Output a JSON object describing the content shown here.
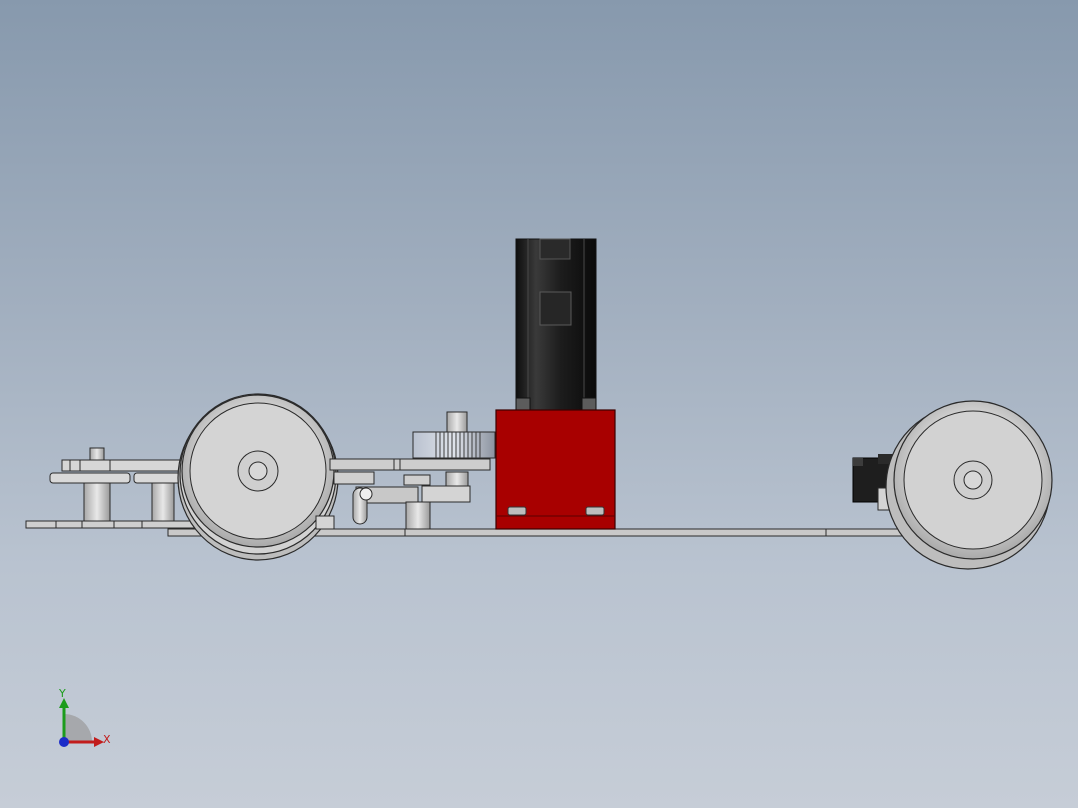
{
  "viewport": {
    "background_top": "#8799ad",
    "background_bottom": "#c6cdd7"
  },
  "model": {
    "motor_color": "#a60000",
    "motor_body_color": "#1e1e1e",
    "part_color": "#c8c8c8",
    "edge_color": "#2a2a2a"
  },
  "triad": {
    "y_label": "Y",
    "x_label": "X",
    "y_color": "#1c9c1c",
    "x_color": "#c21c1c",
    "z_color": "#1c2cc8"
  }
}
